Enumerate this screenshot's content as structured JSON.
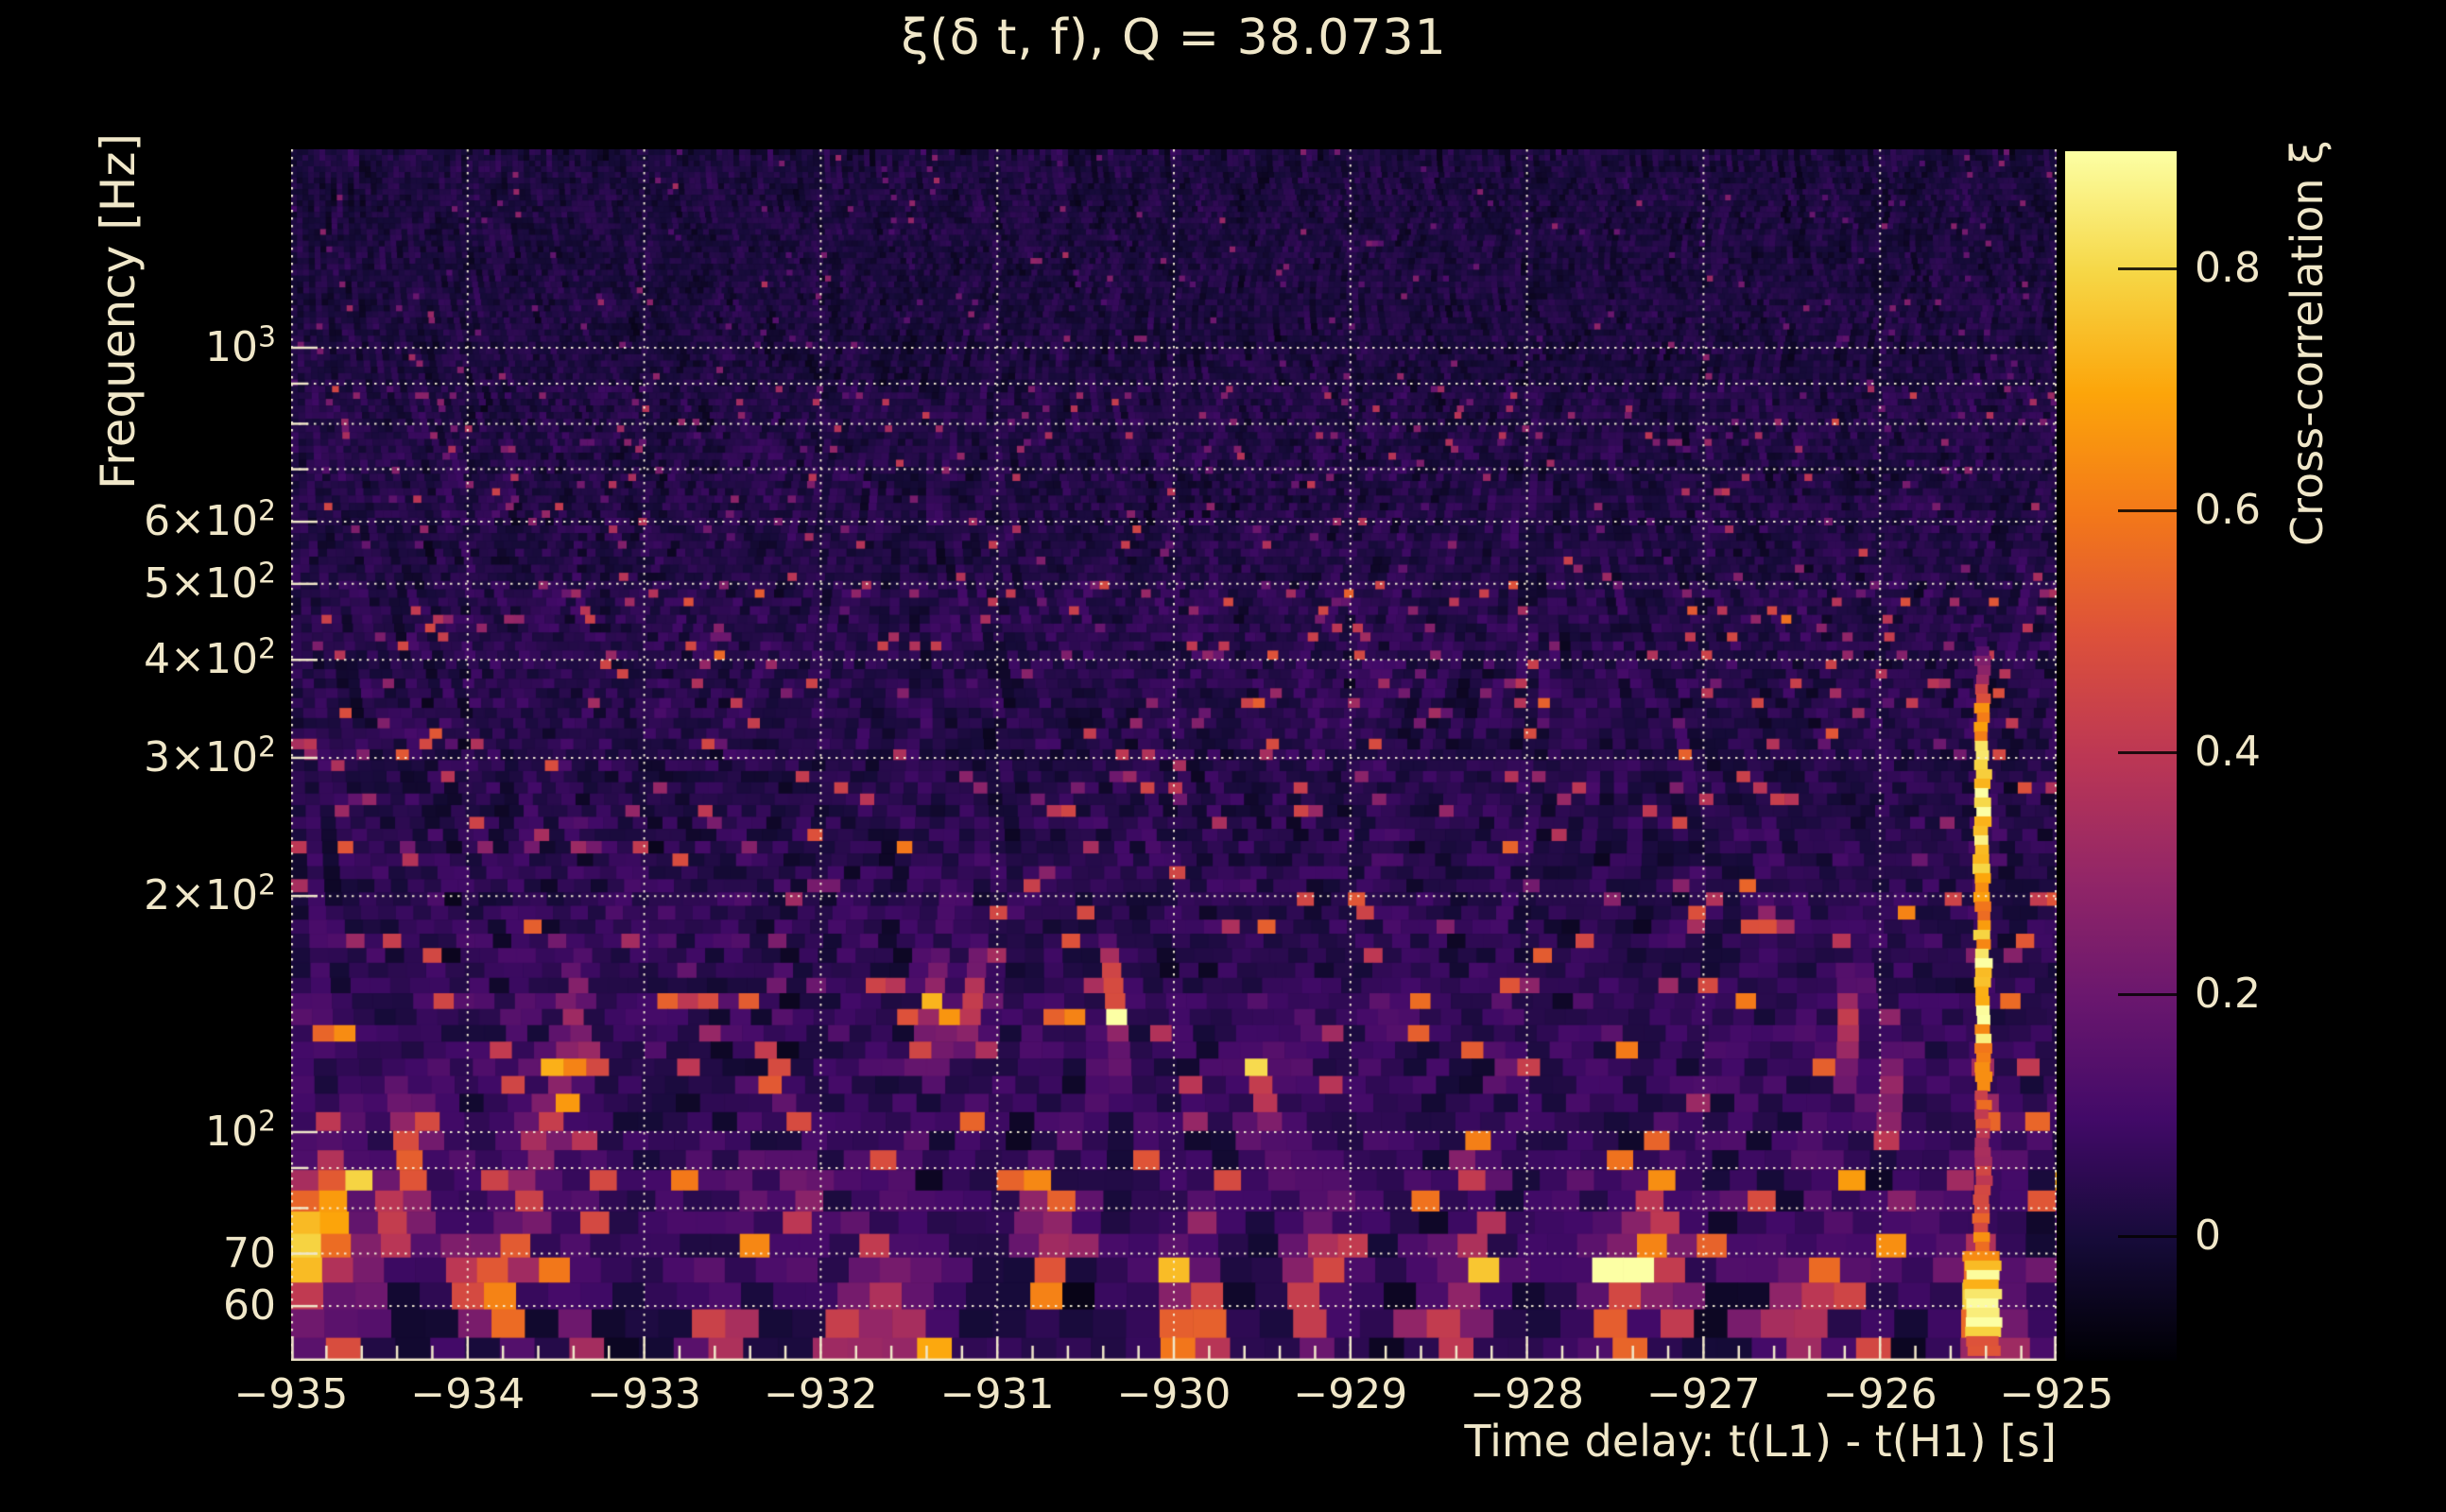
{
  "figure": {
    "background": "#000000",
    "text_color": "#f0e7c9",
    "grid_color": "#f5eed6"
  },
  "title": "ξ(δ t, f), Q = 38.0731",
  "chart_data": {
    "type": "heatmap",
    "title": "ξ(δ t, f), Q = 38.0731",
    "q_value": 38.0731,
    "xlabel": "Time delay: t(L1) - t(H1) [s]",
    "ylabel": "Frequency [Hz]",
    "colorbar_label": "Cross-correlation ξ",
    "x_range_s": [
      -935,
      -925
    ],
    "x_major_tick_step_s": 1,
    "x_minor_tick_step_s": 0.2,
    "x_ticks": [
      {
        "v": -935,
        "label": "−935"
      },
      {
        "v": -934,
        "label": "−934"
      },
      {
        "v": -933,
        "label": "−933"
      },
      {
        "v": -932,
        "label": "−932"
      },
      {
        "v": -931,
        "label": "−931"
      },
      {
        "v": -930,
        "label": "−930"
      },
      {
        "v": -929,
        "label": "−929"
      },
      {
        "v": -928,
        "label": "−928"
      },
      {
        "v": -927,
        "label": "−927"
      },
      {
        "v": -926,
        "label": "−926"
      },
      {
        "v": -925,
        "label": "−925"
      }
    ],
    "y_scale": "log",
    "y_range_hz": [
      51,
      1791
    ],
    "y_major_ticks": [
      {
        "f": 1000,
        "base": "10",
        "sup": "3"
      },
      {
        "f": 600,
        "base": "6×10",
        "sup": "2"
      },
      {
        "f": 500,
        "base": "5×10",
        "sup": "2"
      },
      {
        "f": 400,
        "base": "4×10",
        "sup": "2"
      },
      {
        "f": 300,
        "base": "3×10",
        "sup": "2"
      },
      {
        "f": 200,
        "base": "2×10",
        "sup": "2"
      },
      {
        "f": 100,
        "base": "10",
        "sup": "2"
      },
      {
        "f": 70,
        "base": "70",
        "sup": ""
      },
      {
        "f": 60,
        "base": "60",
        "sup": ""
      }
    ],
    "y_minor_gridlines_hz": [
      900,
      800,
      700,
      90,
      80
    ],
    "grid_style": "dotted",
    "tick_direction": "in",
    "colormap": "inferno",
    "colormap_stops": [
      "#000004",
      "#160b39",
      "#420a68",
      "#6a176e",
      "#932667",
      "#bc3754",
      "#dd513a",
      "#f37819",
      "#fca50a",
      "#f6d746",
      "#fcffa4"
    ],
    "colorbar_range": [
      -0.103,
      0.897
    ],
    "colorbar_ticks": [
      {
        "v": 0.8,
        "label": "0.8"
      },
      {
        "v": 0.6,
        "label": "0.6"
      },
      {
        "v": 0.4,
        "label": "0.4"
      },
      {
        "v": 0.2,
        "label": "0.2"
      },
      {
        "v": 0.0,
        "label": "0"
      }
    ],
    "background_noise": {
      "description": "dark purple Q-transform noise field, vertical grain, activity increasing toward low frequency",
      "value_range": [
        -0.08,
        0.2
      ]
    },
    "features": [
      {
        "t": -934.88,
        "f": 74,
        "amp": 0.55,
        "st": 0.1,
        "sf": 0.055
      },
      {
        "t": -934.95,
        "f": 66,
        "amp": 0.42,
        "st": 0.06,
        "sf": 0.045
      },
      {
        "t": -934.74,
        "f": 82,
        "amp": 0.38,
        "st": 0.05,
        "sf": 0.05
      },
      {
        "t": -934.6,
        "f": 62,
        "amp": 0.28,
        "st": 0.07,
        "sf": 0.05
      },
      {
        "t": -934.32,
        "f": 92,
        "amp": 0.42,
        "st": 0.07,
        "sf": 0.055
      },
      {
        "t": -934.42,
        "f": 80,
        "amp": 0.32,
        "st": 0.05,
        "sf": 0.045
      },
      {
        "t": -933.97,
        "f": 64,
        "amp": 0.5,
        "st": 0.09,
        "sf": 0.04
      },
      {
        "t": -933.78,
        "f": 61,
        "amp": 0.55,
        "st": 0.07,
        "sf": 0.042
      },
      {
        "t": -933.63,
        "f": 88,
        "amp": 0.4,
        "st": 0.045,
        "sf": 0.055
      },
      {
        "t": -933.52,
        "f": 108,
        "amp": 0.34,
        "st": 0.04,
        "sf": 0.05
      },
      {
        "t": -933.4,
        "f": 140,
        "amp": 0.3,
        "st": 0.04,
        "sf": 0.05
      },
      {
        "t": -933.35,
        "f": 55,
        "amp": 0.3,
        "st": 0.06,
        "sf": 0.04
      },
      {
        "t": -932.62,
        "f": 52,
        "amp": 0.5,
        "st": 0.08,
        "sf": 0.05
      },
      {
        "t": -932.1,
        "f": 80,
        "amp": 0.3,
        "st": 0.05,
        "sf": 0.05
      },
      {
        "t": -931.85,
        "f": 53,
        "amp": 0.52,
        "st": 0.09,
        "sf": 0.05
      },
      {
        "t": -931.6,
        "f": 57,
        "amp": 0.42,
        "st": 0.06,
        "sf": 0.05
      },
      {
        "t": -931.42,
        "f": 52,
        "amp": 0.46,
        "st": 0.07,
        "sf": 0.05
      },
      {
        "t": -931.35,
        "f": 140,
        "amp": 0.42,
        "st": 0.05,
        "sf": 0.05
      },
      {
        "t": -931.15,
        "f": 150,
        "amp": 0.38,
        "st": 0.04,
        "sf": 0.05
      },
      {
        "t": -930.73,
        "f": 77,
        "amp": 0.44,
        "st": 0.05,
        "sf": 0.05
      },
      {
        "t": -930.35,
        "f": 148,
        "amp": 0.42,
        "st": 0.05,
        "sf": 0.055
      },
      {
        "t": -929.97,
        "f": 53,
        "amp": 0.62,
        "st": 0.11,
        "sf": 0.055
      },
      {
        "t": -929.78,
        "f": 58,
        "amp": 0.4,
        "st": 0.06,
        "sf": 0.05
      },
      {
        "t": -929.5,
        "f": 110,
        "amp": 0.4,
        "st": 0.05,
        "sf": 0.05
      },
      {
        "t": -929.22,
        "f": 60,
        "amp": 0.45,
        "st": 0.06,
        "sf": 0.05
      },
      {
        "t": -929.12,
        "f": 72,
        "amp": 0.36,
        "st": 0.05,
        "sf": 0.05
      },
      {
        "t": -928.45,
        "f": 55,
        "amp": 0.42,
        "st": 0.08,
        "sf": 0.05
      },
      {
        "t": -928.3,
        "f": 66,
        "amp": 0.32,
        "st": 0.05,
        "sf": 0.05
      },
      {
        "t": -927.5,
        "f": 60,
        "amp": 0.5,
        "st": 0.08,
        "sf": 0.055
      },
      {
        "t": -927.28,
        "f": 72,
        "amp": 0.5,
        "st": 0.07,
        "sf": 0.055
      },
      {
        "t": -927.12,
        "f": 58,
        "amp": 0.4,
        "st": 0.05,
        "sf": 0.05
      },
      {
        "t": -926.5,
        "f": 55,
        "amp": 0.46,
        "st": 0.09,
        "sf": 0.05
      },
      {
        "t": -926.33,
        "f": 60,
        "amp": 0.36,
        "st": 0.05,
        "sf": 0.045
      },
      {
        "t": -926.15,
        "f": 130,
        "amp": 0.42,
        "st": 0.045,
        "sf": 0.06
      },
      {
        "t": -925.9,
        "f": 105,
        "amp": 0.36,
        "st": 0.04,
        "sf": 0.05
      },
      {
        "t": -925.45,
        "f": 61,
        "amp": 0.6,
        "st": 0.075,
        "sf": 0.05
      },
      {
        "t": -925.2,
        "f": 52,
        "amp": 0.42,
        "st": 0.06,
        "sf": 0.045
      }
    ],
    "streak": {
      "t": -925.42,
      "f_min": 52,
      "f_max": 440,
      "width_s": 0.055,
      "base_amp": 0.38,
      "peaks": [
        {
          "f": 265,
          "amp": 0.5,
          "sfl": 0.09
        },
        {
          "f": 150,
          "amp": 0.42,
          "sfl": 0.08
        },
        {
          "f": 60,
          "amp": 0.45,
          "sfl": 0.07
        }
      ]
    }
  }
}
